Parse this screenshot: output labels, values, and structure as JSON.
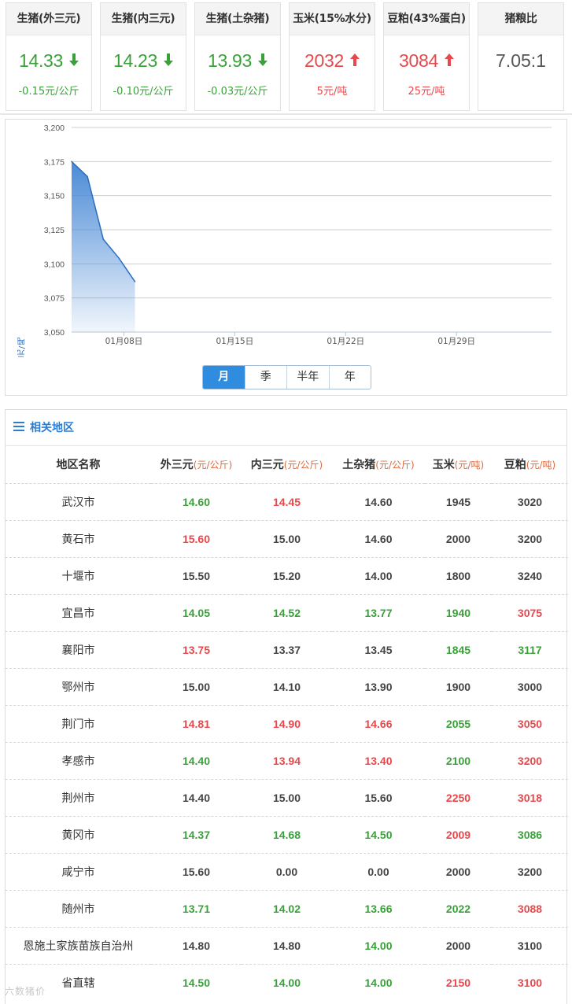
{
  "cards": [
    {
      "title": "生猪(外三元)",
      "value": "14.33",
      "direction": "down",
      "change": "-0.15元/公斤",
      "color": "#3aa13a"
    },
    {
      "title": "生猪(内三元)",
      "value": "14.23",
      "direction": "down",
      "change": "-0.10元/公斤",
      "color": "#3aa13a"
    },
    {
      "title": "生猪(土杂猪)",
      "value": "13.93",
      "direction": "down",
      "change": "-0.03元/公斤",
      "color": "#3aa13a"
    },
    {
      "title": "玉米(15%水分)",
      "value": "2032",
      "direction": "up",
      "change": "5元/吨",
      "color": "#e8484c"
    },
    {
      "title": "豆粕(43%蛋白)",
      "value": "3084",
      "direction": "up",
      "change": "25元/吨",
      "color": "#e8484c"
    }
  ],
  "ratio_card": {
    "title": "猪粮比",
    "value": "7.05:1"
  },
  "chart_data": {
    "type": "area",
    "ylabel": "元/吨",
    "ylim": [
      3050,
      3200
    ],
    "yticks": [
      "3,200",
      "3,175",
      "3,150",
      "3,125",
      "3,100",
      "3,075",
      "3,050"
    ],
    "ytick_values": [
      3200,
      3175,
      3150,
      3125,
      3100,
      3075,
      3050
    ],
    "xticks": [
      "01月08日",
      "01月15日",
      "01月22日",
      "01月29日"
    ],
    "x_tick_days": [
      8,
      15,
      22,
      29
    ],
    "x_range_days": [
      4.7,
      35
    ],
    "x": [
      "01月05日",
      "01月06日",
      "01月07日",
      "01月08日",
      "01月09日"
    ],
    "x_days": [
      4.7,
      5.7,
      6.7,
      7.7,
      8.7
    ],
    "values": [
      3175,
      3164,
      3118,
      3104,
      3087
    ],
    "line_color": "#2a6ebd",
    "fill_color": "#4a8ad6",
    "grid": true
  },
  "range_buttons": [
    {
      "label": "月",
      "active": true
    },
    {
      "label": "季",
      "active": false
    },
    {
      "label": "半年",
      "active": false
    },
    {
      "label": "年",
      "active": false
    }
  ],
  "region_section": {
    "title": "相关地区",
    "headers": [
      {
        "label": "地区名称",
        "unit": ""
      },
      {
        "label": "外三元",
        "unit": "(元/公斤)"
      },
      {
        "label": "内三元",
        "unit": "(元/公斤)"
      },
      {
        "label": "土杂猪",
        "unit": "(元/公斤)"
      },
      {
        "label": "玉米",
        "unit": "(元/吨)"
      },
      {
        "label": "豆粕",
        "unit": "(元/吨)"
      }
    ],
    "rows": [
      {
        "name": "武汉市",
        "cells": [
          [
            "14.60",
            "green"
          ],
          [
            "14.45",
            "red"
          ],
          [
            "14.60",
            "normal"
          ],
          [
            "1945",
            "normal"
          ],
          [
            "3020",
            "normal"
          ]
        ]
      },
      {
        "name": "黄石市",
        "cells": [
          [
            "15.60",
            "red"
          ],
          [
            "15.00",
            "normal"
          ],
          [
            "14.60",
            "normal"
          ],
          [
            "2000",
            "normal"
          ],
          [
            "3200",
            "normal"
          ]
        ]
      },
      {
        "name": "十堰市",
        "cells": [
          [
            "15.50",
            "normal"
          ],
          [
            "15.20",
            "normal"
          ],
          [
            "14.00",
            "normal"
          ],
          [
            "1800",
            "normal"
          ],
          [
            "3240",
            "normal"
          ]
        ]
      },
      {
        "name": "宜昌市",
        "cells": [
          [
            "14.05",
            "green"
          ],
          [
            "14.52",
            "green"
          ],
          [
            "13.77",
            "green"
          ],
          [
            "1940",
            "green"
          ],
          [
            "3075",
            "red"
          ]
        ]
      },
      {
        "name": "襄阳市",
        "cells": [
          [
            "13.75",
            "red"
          ],
          [
            "13.37",
            "normal"
          ],
          [
            "13.45",
            "normal"
          ],
          [
            "1845",
            "green"
          ],
          [
            "3117",
            "green"
          ]
        ]
      },
      {
        "name": "鄂州市",
        "cells": [
          [
            "15.00",
            "normal"
          ],
          [
            "14.10",
            "normal"
          ],
          [
            "13.90",
            "normal"
          ],
          [
            "1900",
            "normal"
          ],
          [
            "3000",
            "normal"
          ]
        ]
      },
      {
        "name": "荆门市",
        "cells": [
          [
            "14.81",
            "red"
          ],
          [
            "14.90",
            "red"
          ],
          [
            "14.66",
            "red"
          ],
          [
            "2055",
            "green"
          ],
          [
            "3050",
            "red"
          ]
        ]
      },
      {
        "name": "孝感市",
        "cells": [
          [
            "14.40",
            "green"
          ],
          [
            "13.94",
            "red"
          ],
          [
            "13.40",
            "red"
          ],
          [
            "2100",
            "green"
          ],
          [
            "3200",
            "red"
          ]
        ]
      },
      {
        "name": "荆州市",
        "cells": [
          [
            "14.40",
            "normal"
          ],
          [
            "15.00",
            "normal"
          ],
          [
            "15.60",
            "normal"
          ],
          [
            "2250",
            "red"
          ],
          [
            "3018",
            "red"
          ]
        ]
      },
      {
        "name": "黄冈市",
        "cells": [
          [
            "14.37",
            "green"
          ],
          [
            "14.68",
            "green"
          ],
          [
            "14.50",
            "green"
          ],
          [
            "2009",
            "red"
          ],
          [
            "3086",
            "green"
          ]
        ]
      },
      {
        "name": "咸宁市",
        "cells": [
          [
            "15.60",
            "normal"
          ],
          [
            "0.00",
            "normal"
          ],
          [
            "0.00",
            "normal"
          ],
          [
            "2000",
            "normal"
          ],
          [
            "3200",
            "normal"
          ]
        ]
      },
      {
        "name": "随州市",
        "cells": [
          [
            "13.71",
            "green"
          ],
          [
            "14.02",
            "green"
          ],
          [
            "13.66",
            "green"
          ],
          [
            "2022",
            "green"
          ],
          [
            "3088",
            "red"
          ]
        ]
      },
      {
        "name": "恩施土家族苗族自治州",
        "cells": [
          [
            "14.80",
            "normal"
          ],
          [
            "14.80",
            "normal"
          ],
          [
            "14.00",
            "green"
          ],
          [
            "2000",
            "normal"
          ],
          [
            "3100",
            "normal"
          ]
        ]
      },
      {
        "name": "省直辖",
        "cells": [
          [
            "14.50",
            "green"
          ],
          [
            "14.00",
            "green"
          ],
          [
            "14.00",
            "green"
          ],
          [
            "2150",
            "red"
          ],
          [
            "3100",
            "red"
          ]
        ]
      }
    ]
  },
  "watermark": "六数猪价"
}
